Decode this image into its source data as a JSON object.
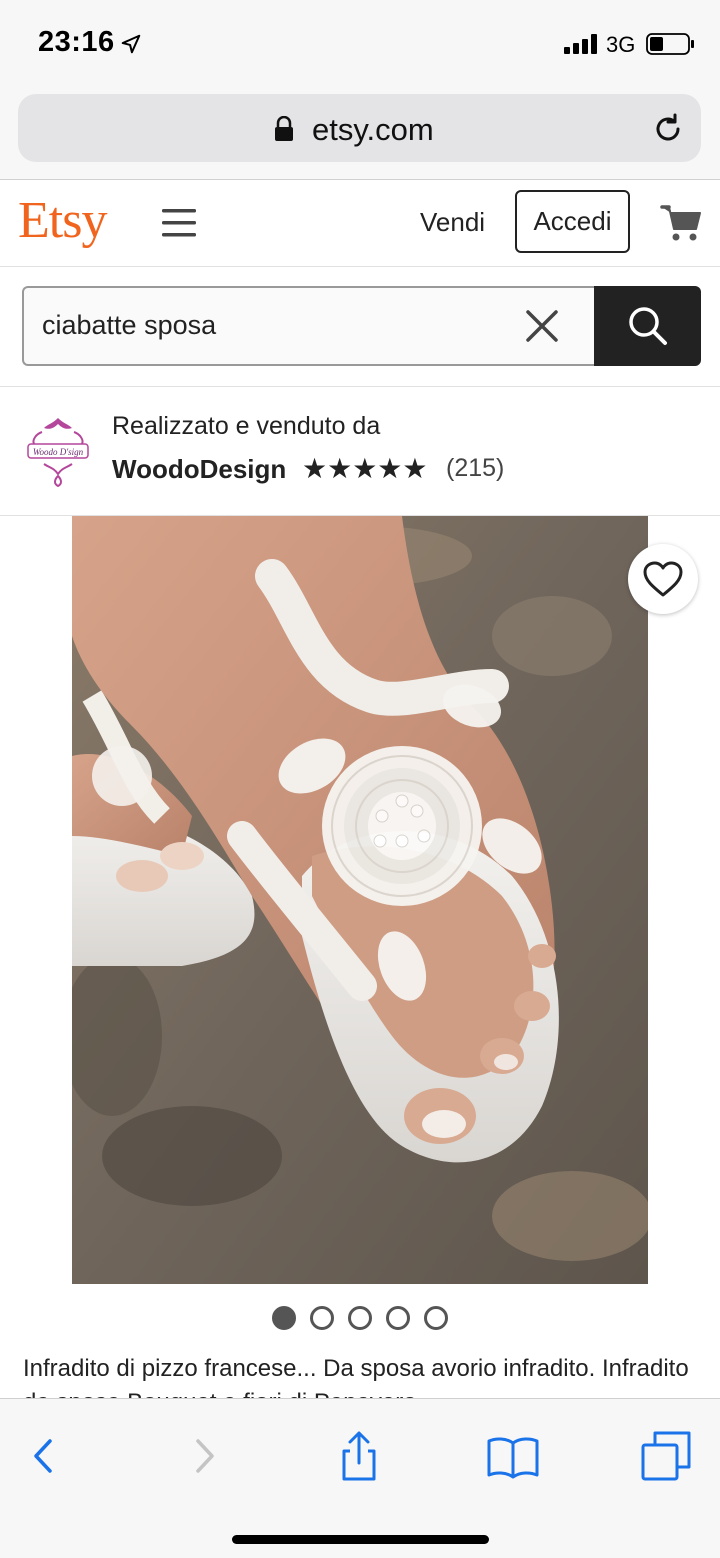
{
  "status_bar": {
    "time": "23:16",
    "network": "3G"
  },
  "browser": {
    "url": "etsy.com"
  },
  "header": {
    "logo": "Etsy",
    "sell_label": "Vendi",
    "signin_label": "Accedi",
    "brand_color": "#f1641e"
  },
  "search": {
    "query": "ciabatte sposa"
  },
  "shop": {
    "caption": "Realizzato e venduto da",
    "name": "WoodoDesign",
    "stars": "★★★★★",
    "reviews": "(215)",
    "rating": 5,
    "logo_text": "Woodo D'sign"
  },
  "gallery": {
    "total_images": 5,
    "active_index": 0
  },
  "product": {
    "title": "Infradito di pizzo francese... Da sposa avorio infradito. Infradito da sposa Bouquet e fiori di Papavero"
  },
  "icons": {
    "location": "location-arrow-icon",
    "lock": "lock-icon",
    "reload": "reload-icon",
    "menu": "hamburger-menu-icon",
    "cart": "cart-icon",
    "clear": "close-icon",
    "search": "search-icon",
    "favorite": "heart-icon",
    "back": "chevron-left-icon",
    "forward": "chevron-right-icon",
    "share": "share-icon",
    "bookmarks": "book-icon",
    "tabs": "tabs-icon"
  }
}
